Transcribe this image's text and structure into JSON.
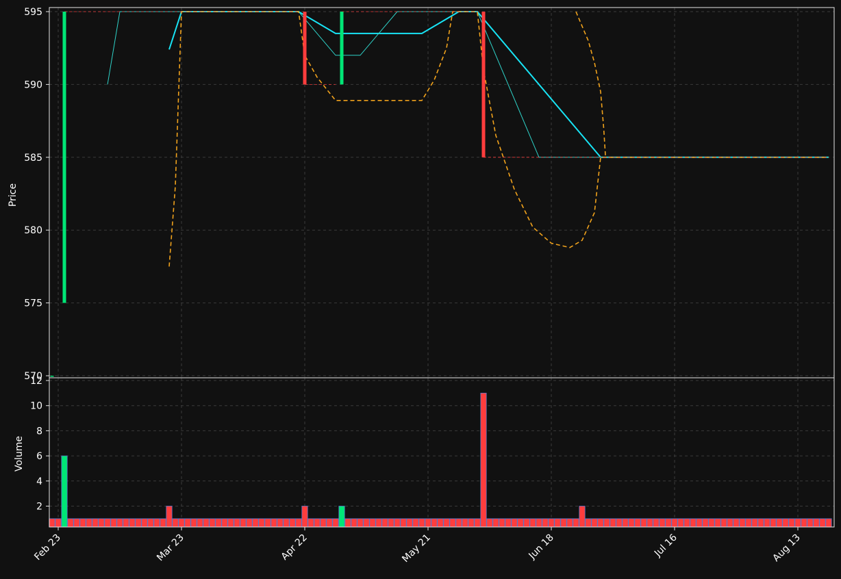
{
  "colors": {
    "background": "#111111",
    "axes_face": "#111111",
    "spine": "#e6e6e6",
    "grid": "#3a3a3a",
    "text": "#ffffff",
    "up": "#00e676",
    "down": "#ff3d3d",
    "fast_ma": "#18e4f5",
    "slow_ma": "#2fd3c9",
    "envelope": "#f0a21c",
    "volume_edge": "#5a76c8"
  },
  "chart_data": [
    {
      "type": "candlestick",
      "ylabel": "Price",
      "ylim": [
        570,
        595.2
      ],
      "y_ticks": [
        570,
        575,
        580,
        585,
        590,
        595
      ],
      "x_tick_labels": [
        "Feb 23",
        "Mar 23",
        "Apr 22",
        "May 21",
        "Jun 18",
        "Jul 16",
        "Aug 13"
      ],
      "x_tick_index": [
        1,
        21,
        41,
        61,
        81,
        101,
        121
      ],
      "bar_count": 127,
      "grid": true,
      "last_close_line": 585,
      "candles": [
        {
          "i": 0,
          "open": 570,
          "high": 570,
          "low": 570,
          "close": 570
        },
        {
          "i": 2,
          "open": 575,
          "high": 595,
          "low": 575,
          "close": 595
        },
        {
          "i": 41,
          "open": 595,
          "high": 595,
          "low": 590,
          "close": 590
        },
        {
          "i": 47,
          "open": 590,
          "high": 595,
          "low": 590,
          "close": 595
        },
        {
          "i": 70,
          "open": 595,
          "high": 595,
          "low": 585,
          "close": 585
        }
      ],
      "flat_close_segments": [
        {
          "from": 2,
          "to": 40,
          "value": 595
        },
        {
          "from": 41,
          "to": 46,
          "value": 590
        },
        {
          "from": 47,
          "to": 69,
          "value": 595
        },
        {
          "from": 70,
          "to": 126,
          "value": 585
        }
      ],
      "series": [
        {
          "style": "line",
          "points": [
            [
              19,
              592.4
            ],
            [
              21,
              595
            ],
            [
              40,
              595
            ],
            [
              46,
              593.5
            ],
            [
              60,
              593.5
            ],
            [
              66,
              595
            ],
            [
              69,
              595
            ],
            [
              89,
              585
            ],
            [
              126,
              585
            ]
          ]
        },
        {
          "style": "line-thin",
          "points": [
            [
              9,
              590
            ],
            [
              11,
              595
            ],
            [
              40,
              595
            ],
            [
              46,
              592
            ],
            [
              50,
              592
            ],
            [
              56,
              595
            ],
            [
              69,
              595
            ],
            [
              79,
              585
            ],
            [
              126,
              585
            ]
          ]
        },
        {
          "style": "dashed",
          "points": [
            [
              19,
              577.5
            ],
            [
              20,
              583
            ],
            [
              21,
              595
            ],
            [
              40,
              595
            ],
            [
              41,
              592
            ],
            [
              43,
              590.5
            ],
            [
              46,
              588.9
            ],
            [
              60,
              588.9
            ],
            [
              62,
              590.3
            ],
            [
              64,
              592.5
            ],
            [
              65,
              595
            ],
            [
              68,
              595
            ],
            [
              69,
              595
            ],
            [
              70,
              591
            ],
            [
              72,
              586.5
            ],
            [
              75,
              582.8
            ],
            [
              78,
              580.2
            ],
            [
              81,
              579.1
            ],
            [
              84,
              578.8
            ],
            [
              86,
              579.3
            ],
            [
              88,
              581.2
            ],
            [
              89,
              585
            ],
            [
              126,
              585
            ]
          ]
        },
        {
          "style": "dashed",
          "points": [
            [
              85,
              595
            ],
            [
              87,
              593
            ],
            [
              88,
              591.5
            ],
            [
              89,
              589.5
            ],
            [
              89.5,
              587
            ],
            [
              89.8,
              585
            ]
          ]
        }
      ]
    },
    {
      "type": "bar",
      "ylabel": "Volume",
      "ylim": [
        0.4,
        12
      ],
      "y_ticks": [
        2,
        4,
        6,
        8,
        10,
        12
      ],
      "bar_count": 127,
      "default_value": 1,
      "special_values": {
        "2": 6,
        "19": 2,
        "41": 2,
        "47": 2,
        "70": 11,
        "86": 2
      },
      "up_bars": [
        2,
        47
      ]
    }
  ]
}
